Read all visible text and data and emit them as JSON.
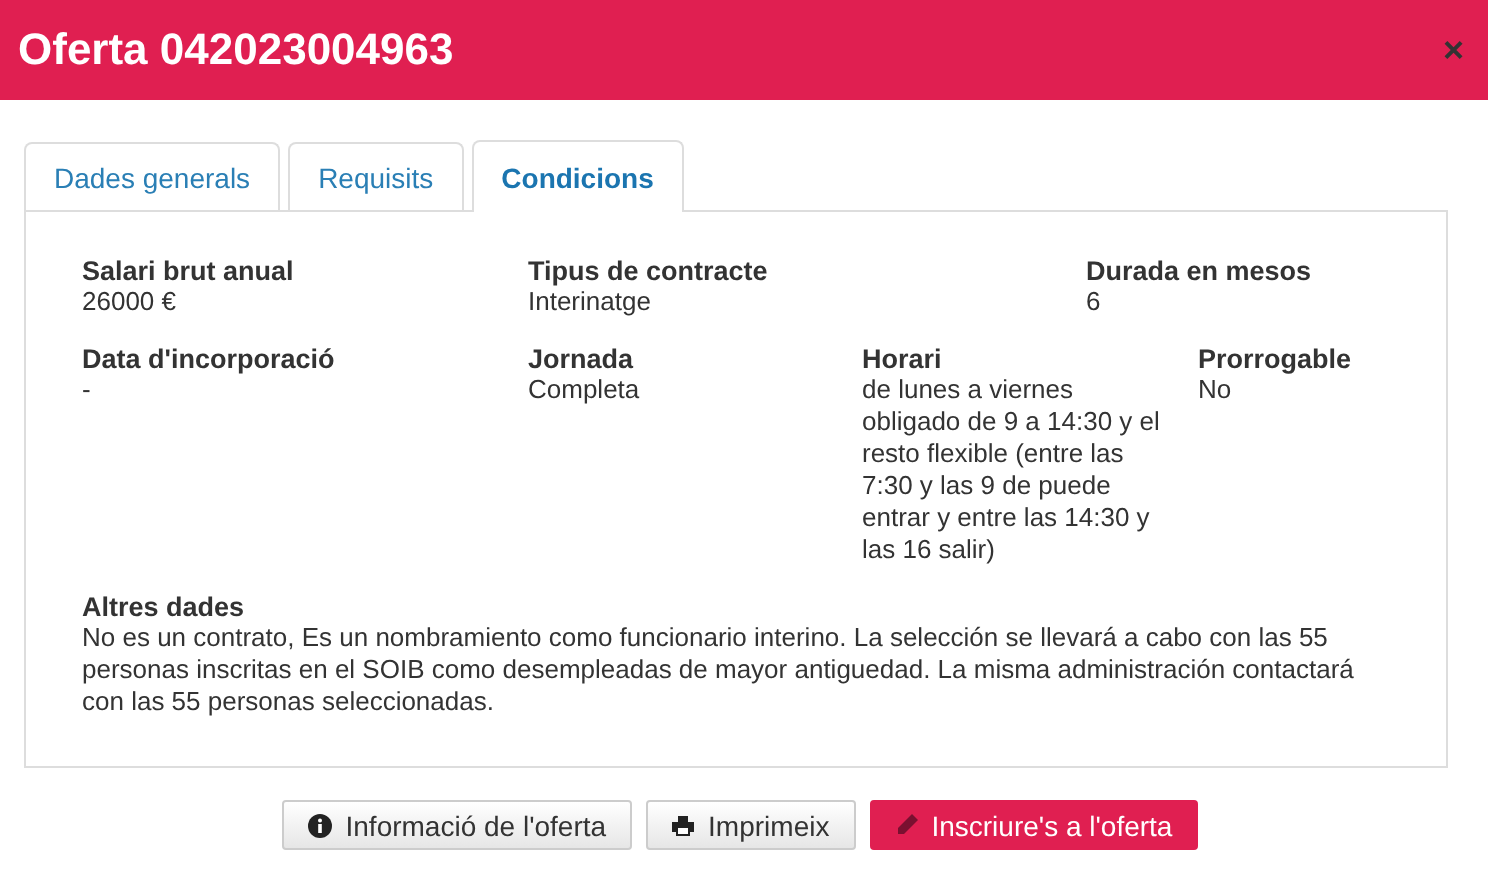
{
  "window": {
    "title": "Oferta 042023004963",
    "close": "×"
  },
  "tabs": [
    {
      "label": "Dades generals",
      "selected": false
    },
    {
      "label": "Requisits",
      "selected": false
    },
    {
      "label": "Condicions",
      "selected": true
    }
  ],
  "rows": [
    [
      {
        "label": "Salari brut anual",
        "value": "26000 €"
      },
      {
        "label": "Tipus de contracte",
        "value": "Interinatge"
      },
      {
        "label": "Durada en mesos",
        "value": "6"
      }
    ],
    [
      {
        "label": "Data d'incorporació",
        "value": "-"
      },
      {
        "label": "Jornada",
        "value": "Completa"
      },
      {
        "label": "Horari",
        "value": "de lunes a viernes obligado de 9 a 14:30 y el resto flexible (entre las 7:30 y las 9 de puede entrar y entre las 14:30 y las 16 salir)"
      },
      {
        "label": "Prorrogable",
        "value": "No"
      }
    ]
  ],
  "other": {
    "label": "Altres dades",
    "value": "No es un contrato, Es un nombramiento como funcionario interino. La selección se llevará a cabo con las 55 personas inscritas en el SOIB como desempleadas de mayor antiguedad. La misma administración contactará con las 55 personas seleccionadas."
  },
  "buttons": [
    {
      "label": "Informació de l'oferta",
      "kind": "default"
    },
    {
      "label": "Imprimeix",
      "kind": "default"
    },
    {
      "label": "Inscriure's a l'oferta",
      "kind": "primary"
    }
  ]
}
